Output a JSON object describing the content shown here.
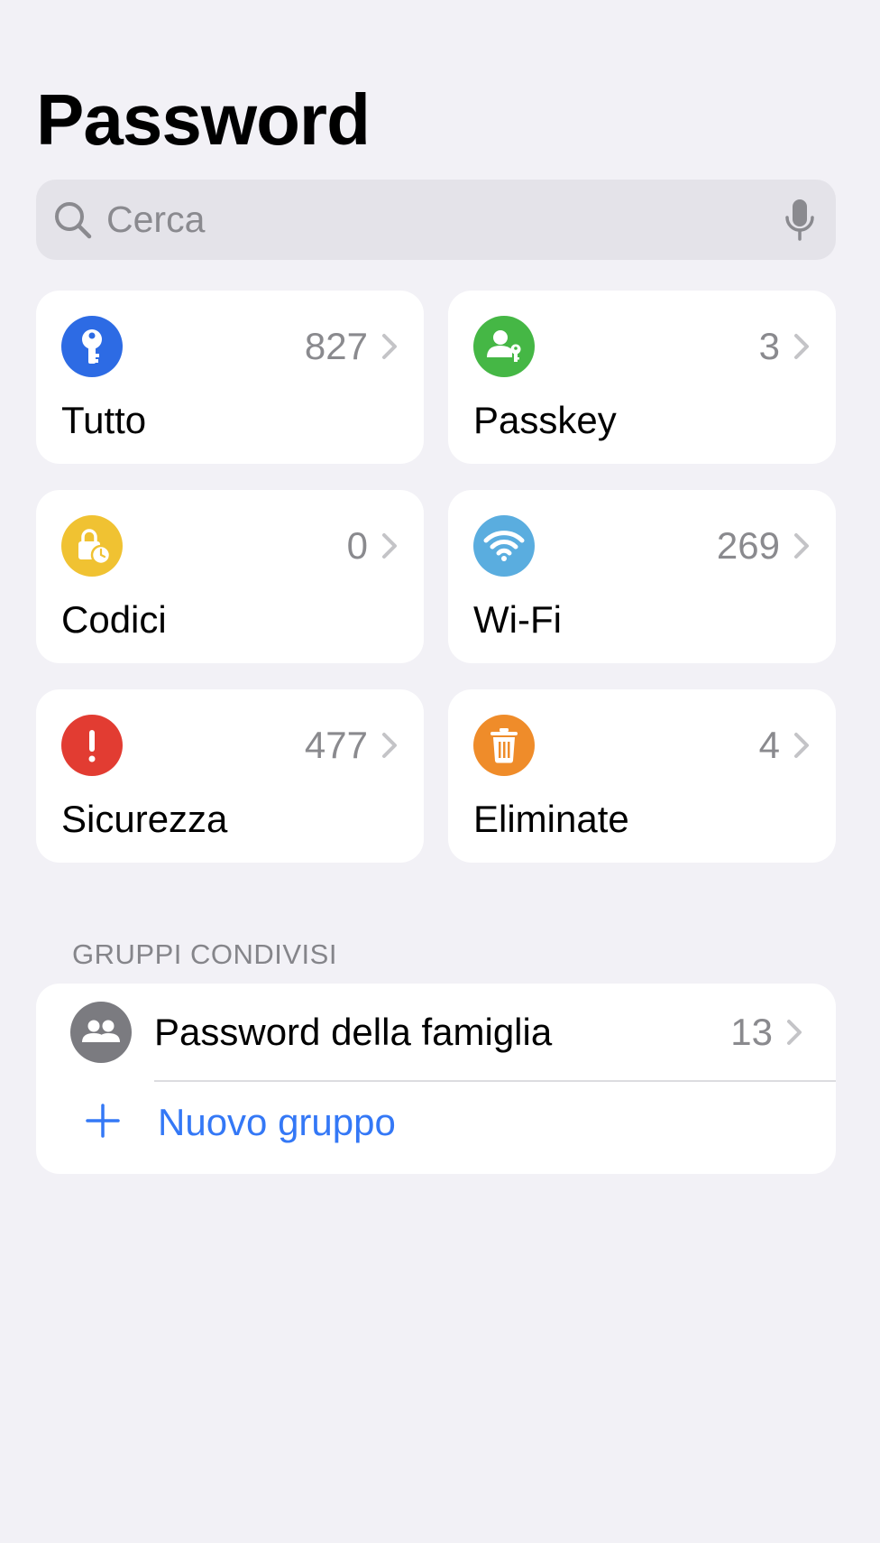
{
  "header": {
    "title": "Password"
  },
  "search": {
    "placeholder": "Cerca"
  },
  "categories": [
    {
      "label": "Tutto",
      "count": "827",
      "icon": "key-icon",
      "color": "#2d6be4"
    },
    {
      "label": "Passkey",
      "count": "3",
      "icon": "person-key-icon",
      "color": "#45b745"
    },
    {
      "label": "Codici",
      "count": "0",
      "icon": "lock-clock-icon",
      "color": "#f0c232"
    },
    {
      "label": "Wi-Fi",
      "count": "269",
      "icon": "wifi-icon",
      "color": "#5aaddf"
    },
    {
      "label": "Sicurezza",
      "count": "477",
      "icon": "exclamation-icon",
      "color": "#e23c32"
    },
    {
      "label": "Eliminate",
      "count": "4",
      "icon": "trash-icon",
      "color": "#ef8c2a"
    }
  ],
  "shared_groups": {
    "header": "GRUPPI CONDIVISI",
    "items": [
      {
        "label": "Password della famiglia",
        "count": "13",
        "icon": "people-icon",
        "color": "#7b7b80"
      }
    ],
    "new_group_label": "Nuovo gruppo"
  },
  "colors": {
    "background": "#f2f1f6",
    "accent": "#3478f6"
  }
}
